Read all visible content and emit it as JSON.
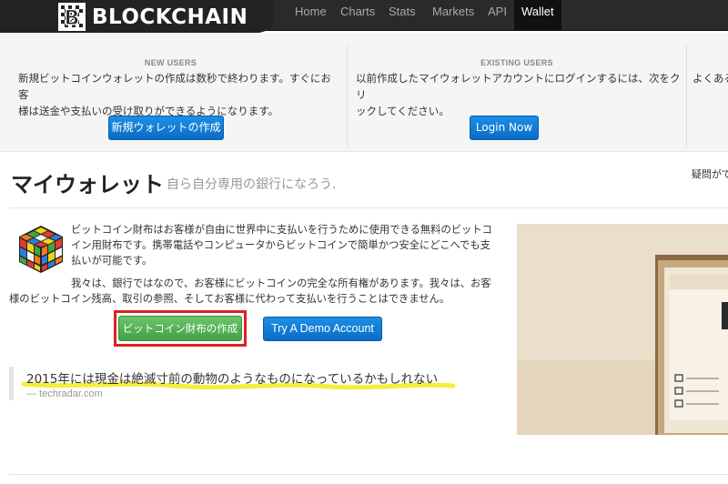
{
  "brand": {
    "name": "BLOCKCHAIN"
  },
  "nav": {
    "items": [
      {
        "label": "Home"
      },
      {
        "label": "Charts"
      },
      {
        "label": "Stats"
      },
      {
        "label": "Markets"
      },
      {
        "label": "API"
      },
      {
        "label": "Wallet",
        "active": true
      }
    ]
  },
  "hero": {
    "new_users": {
      "heading": "NEW USERS",
      "text_line1": "新規ビットコインウォレットの作成は数秒で終わります。すぐにお客",
      "text_line2": "様は送金や支払いの受け取りができるようになります。",
      "button": "新規ウォレットの作成"
    },
    "existing_users": {
      "heading": "EXISTING USERS",
      "text_line1": "以前作成したマイウォレットアカウントにログインするには、次をクリ",
      "text_line2": "ックしてください。",
      "button": "Login Now"
    },
    "third_partial": {
      "text": "よくある"
    }
  },
  "page": {
    "title": "マイウォレット",
    "subtitle": "自ら自分専用の銀行になろう.",
    "right_partial": "疑問がで"
  },
  "content": {
    "para1": "ビットコイン財布はお客様が自由に世界中に支払いを行うために使用できる無料のビットコイン用財布です。携帯電話やコンピュータからビットコインで簡単かつ安全にどこへでも支払いが可能です。",
    "para2": "我々は、銀行ではなので、お客様にビットコインの完全な所有権があります。我々は、お客様のビットコイン残高、取引の参照、そしてお客様に代わって支払いを行うことはできません。",
    "create_button": "ビットコイン財布の作成",
    "demo_button": "Try A Demo Account"
  },
  "quote": {
    "text": "2015年には現金は絶滅寸前の動物のようなものになっているかもしれない",
    "source": "— techradar.com"
  },
  "colors": {
    "navbar": "#2a2a2a",
    "accent_blue": "#0a6cc7",
    "accent_green": "#43a047",
    "annotation_red": "#e02020",
    "highlight_yellow": "#f5ee3a"
  }
}
